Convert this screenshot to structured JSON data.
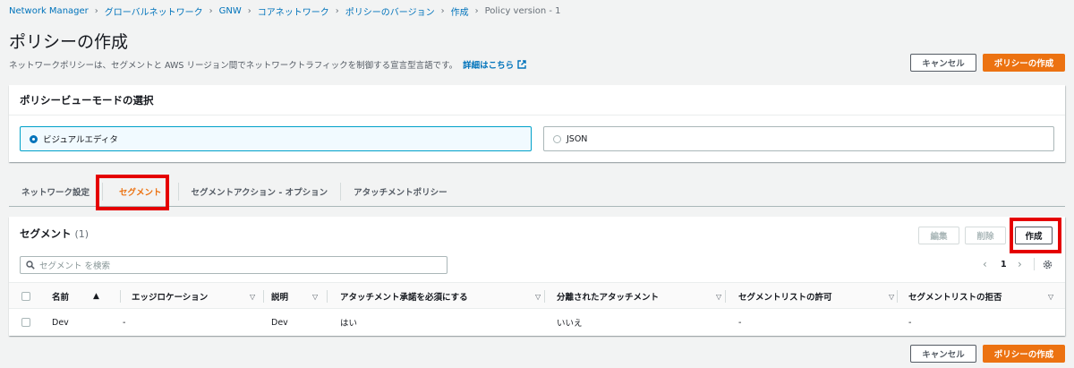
{
  "breadcrumbs": [
    "Network Manager",
    "グローバルネットワーク",
    "GNW",
    "コアネットワーク",
    "ポリシーのバージョン",
    "作成",
    "Policy version - 1"
  ],
  "page": {
    "title": "ポリシーの作成",
    "description": "ネットワークポリシーは、セグメントと AWS リージョン間でネットワークトラフィックを制御する宣言型言語です。",
    "details_link": "詳細はこちら",
    "cancel_label": "キャンセル",
    "create_policy_label": "ポリシーの作成"
  },
  "view_mode": {
    "heading": "ポリシービューモードの選択",
    "options": [
      {
        "label": "ビジュアルエディタ",
        "selected": true
      },
      {
        "label": "JSON",
        "selected": false
      }
    ]
  },
  "tabs": [
    {
      "label": "ネットワーク設定",
      "active": false
    },
    {
      "label": "セグメント",
      "active": true
    },
    {
      "label": "セグメントアクション - オプション",
      "active": false
    },
    {
      "label": "アタッチメントポリシー",
      "active": false
    }
  ],
  "segments": {
    "heading": "セグメント",
    "count": "(1)",
    "edit_label": "編集",
    "delete_label": "削除",
    "create_label": "作成",
    "search_placeholder": "セグメント を検索",
    "page_number": "1",
    "columns": [
      "名前",
      "エッジロケーション",
      "説明",
      "アタッチメント承諾を必須にする",
      "分離されたアタッチメント",
      "セグメントリストの許可",
      "セグメントリストの拒否"
    ],
    "rows": [
      [
        "Dev",
        "-",
        "Dev",
        "はい",
        "いいえ",
        "-",
        "-"
      ]
    ]
  },
  "colors": {
    "accent": "#ec7211",
    "link": "#0073bb",
    "highlight": "#e50000"
  },
  "icons": [
    "chevron-right-icon",
    "external-link-icon",
    "search-icon",
    "sort-ascending-icon",
    "sort-descending-icon",
    "chevron-left-icon",
    "gear-icon",
    "radio-icon",
    "checkbox-icon"
  ]
}
